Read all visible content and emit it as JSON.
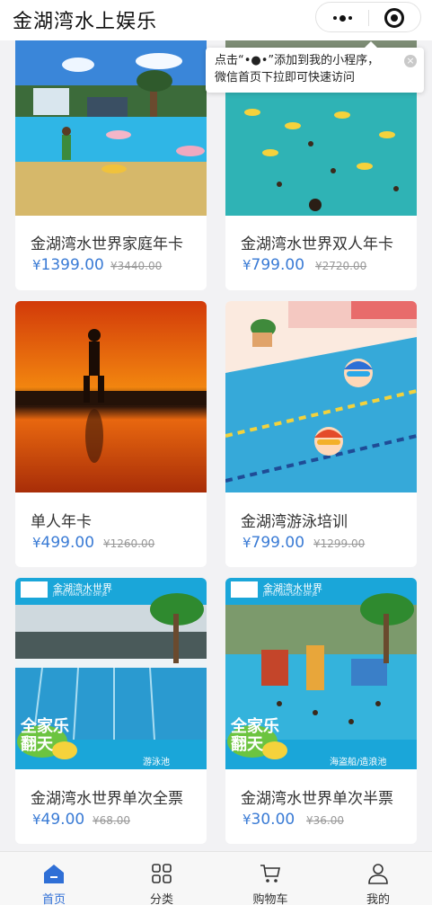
{
  "app": {
    "title": "金湖湾水上娱乐"
  },
  "tooltip": {
    "line1": "点击“•●•”添加到我的小程序，",
    "line2": "微信首页下拉即可快速访问",
    "close": "×"
  },
  "products": [
    {
      "name": "金湖湾水世界家庭年卡",
      "price": "1399.00",
      "original": "¥3440.00",
      "image": "wave-pool-beach"
    },
    {
      "name": "金湖湾水世界双人年卡",
      "price": "799.00",
      "original": "¥2720.00",
      "image": "crowded-pool"
    },
    {
      "name": "单人年卡",
      "price": "499.00",
      "original": "¥1260.00",
      "image": "sunset-silhouette"
    },
    {
      "name": "金湖湾游泳培训",
      "price": "799.00",
      "original": "¥1299.00",
      "image": "cartoon-swimmers"
    },
    {
      "name": "金湖湾水世界单次全票",
      "price": "49.00",
      "original": "¥68.00",
      "image": "swimming-pool-poster"
    },
    {
      "name": "金湖湾水世界单次半票",
      "price": "30.00",
      "original": "¥36.00",
      "image": "pirate-ship-poster"
    }
  ],
  "posters": {
    "brand": "金湖湾水世界",
    "brand_sub": "JIN HU WAN SHUI SHI JIE",
    "slogan": "全家乐翻天",
    "pool_label": "游泳池",
    "ship_label": "海盗船/造浪池"
  },
  "currency": "¥",
  "tabs": [
    {
      "label": "首页",
      "icon": "home-icon",
      "active": true
    },
    {
      "label": "分类",
      "icon": "category-grid-icon",
      "active": false
    },
    {
      "label": "购物车",
      "icon": "cart-icon",
      "active": false
    },
    {
      "label": "我的",
      "icon": "user-icon",
      "active": false
    }
  ],
  "colors": {
    "accent": "#3a7bd5",
    "active_tab": "#2f6fd6",
    "strike_price": "#999999"
  }
}
